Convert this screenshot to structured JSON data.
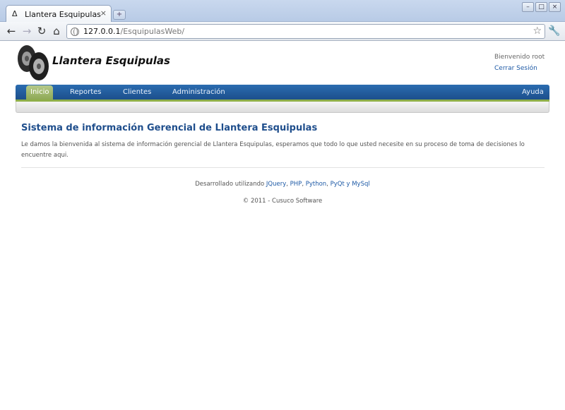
{
  "browser": {
    "tab_title": "Llantera Esquipulas",
    "tab_close_glyph": "×",
    "newtab_glyph": "+",
    "url_host": "127.0.0.1",
    "url_path": "/EsquipulasWeb/",
    "back_glyph": "←",
    "forward_glyph": "→",
    "reload_glyph": "↻",
    "home_glyph": "⌂",
    "star_glyph": "☆",
    "wrench_glyph": "🔧",
    "favicon_glyph": "Δ",
    "window_buttons": [
      "–",
      "□",
      "×"
    ]
  },
  "header": {
    "site_title": "Llantera Esquipulas",
    "welcome": "Bienvenido root",
    "logout": "Cerrar Sesión"
  },
  "nav": {
    "items": [
      "Inicio",
      "Reportes",
      "Clientes",
      "Administración"
    ],
    "active": "Inicio",
    "help": "Ayuda"
  },
  "main": {
    "heading": "Sistema de información Gerencial de Llantera Esquipulas",
    "intro": "Le damos la bienvenida al sistema de información gerencial de Llantera Esquipulas, esperamos que todo lo que usted necesite en su proceso de toma de decisiones lo encuentre aqui."
  },
  "footer": {
    "prefix": "Desarrollado utilizando ",
    "links": [
      "JQuery",
      "PHP",
      "Python",
      "PyQt",
      "MySql"
    ],
    "sep_comma": ", ",
    "sep_y": " y ",
    "copyright": "© 2011 - Cusuco Software"
  },
  "colors": {
    "nav_blue": "#1c4f8c",
    "nav_active": "#8aa650",
    "heading": "#1f4e8c",
    "link": "#1e5aa6"
  }
}
